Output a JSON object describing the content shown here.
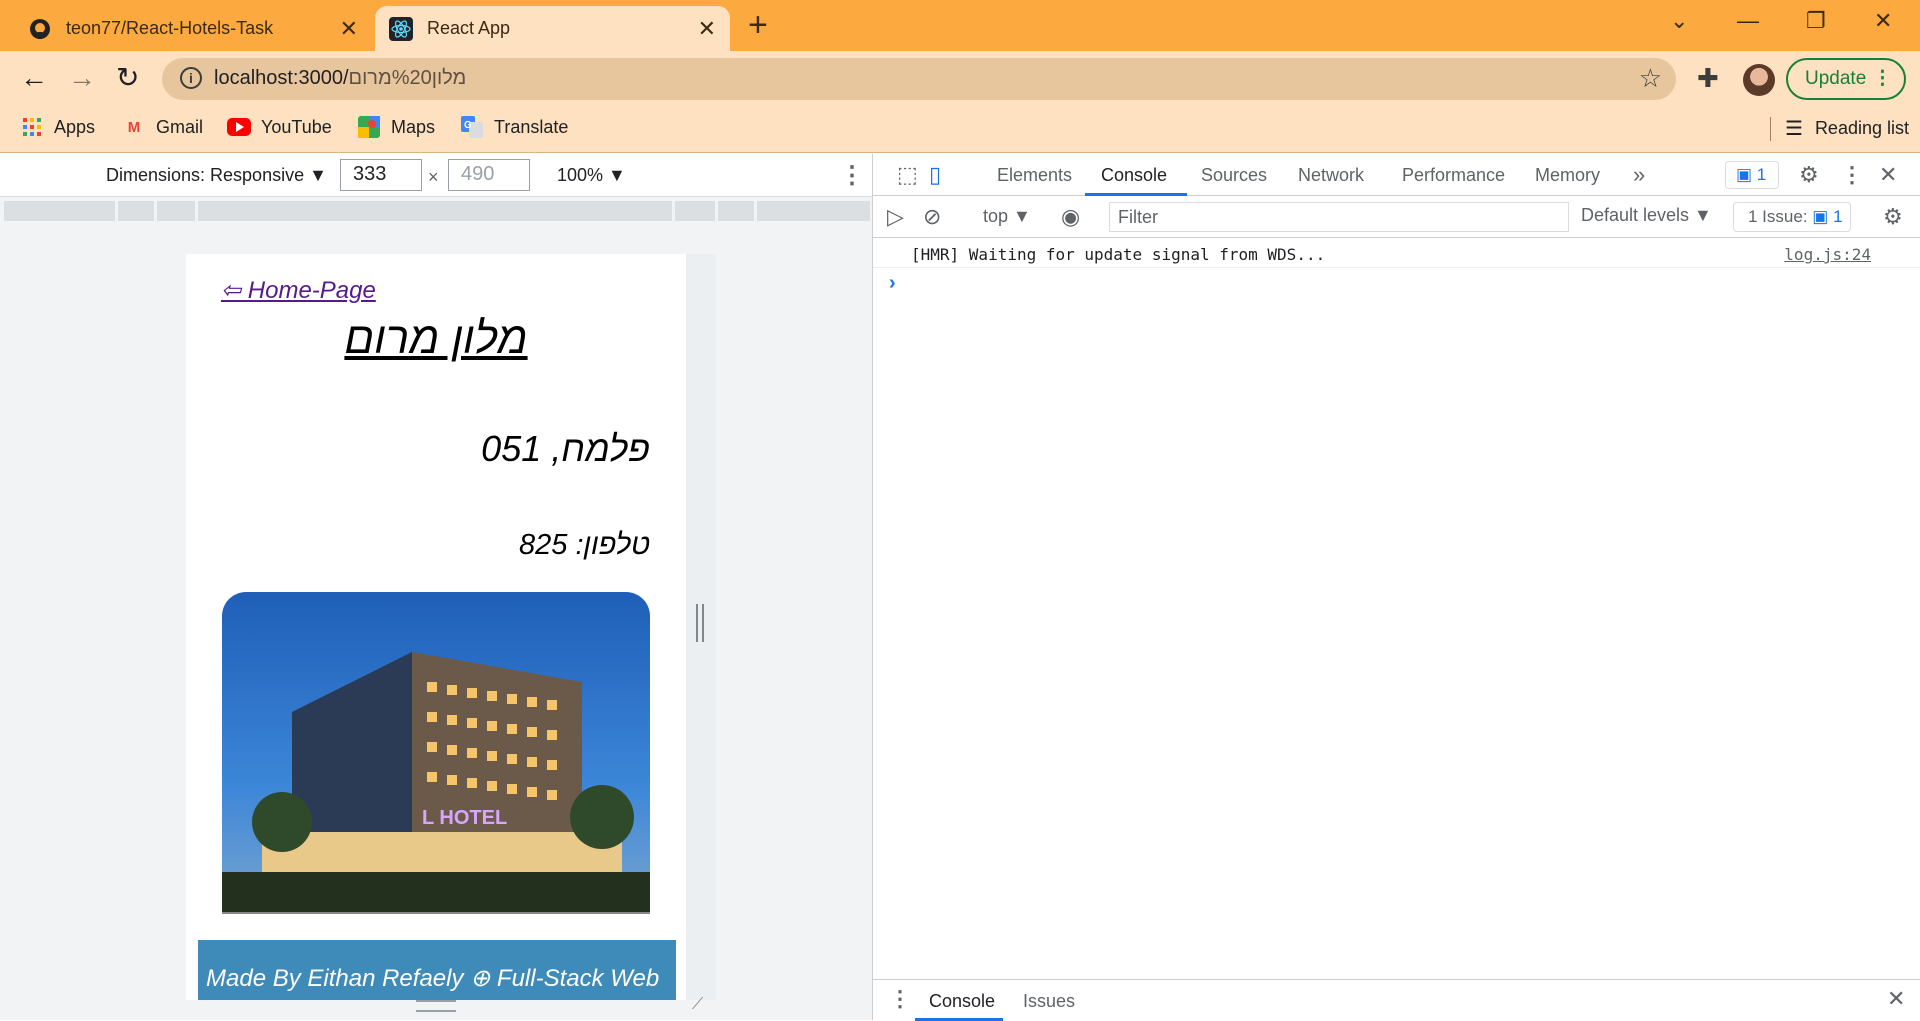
{
  "browser": {
    "tabs": [
      {
        "title": "teon77/React-Hotels-Task",
        "favicon": "github-icon"
      },
      {
        "title": "React App",
        "favicon": "react-icon",
        "active": true
      }
    ],
    "url": {
      "host": "localhost:3000/",
      "path": "מלון%20מרום"
    },
    "update_label": "Update",
    "bookmarks": [
      {
        "label": "Apps",
        "icon": "apps-grid-icon"
      },
      {
        "label": "Gmail",
        "icon": "gmail-icon"
      },
      {
        "label": "YouTube",
        "icon": "youtube-icon"
      },
      {
        "label": "Maps",
        "icon": "maps-icon"
      },
      {
        "label": "Translate",
        "icon": "translate-icon"
      }
    ],
    "reading_list": "Reading list"
  },
  "device_toolbar": {
    "dimensions_label": "Dimensions: Responsive ▼",
    "width": "333",
    "height_placeholder": "490",
    "zoom": "100% ▼",
    "times": "×"
  },
  "page": {
    "home_link": "⇦ Home-Page",
    "title": "מלון מרום",
    "address": "פלמח, 051",
    "phone": "טלפון: 825",
    "image_sign": "L HOTEL",
    "footer": "Made By Eithan Refaely ⊕ Full-Stack Web"
  },
  "devtools": {
    "tabs": [
      "Elements",
      "Console",
      "Sources",
      "Network",
      "Performance",
      "Memory"
    ],
    "active_tab": "Console",
    "message_badge": "1",
    "context": "top ▼",
    "filter_placeholder": "Filter",
    "levels": "Default levels ▼",
    "issues_label": "1 Issue:",
    "issues_count": "1",
    "log_message": "[HMR] Waiting for update signal from WDS...",
    "log_source": "log.js:24",
    "drawer_tabs": [
      "Console",
      "Issues"
    ]
  },
  "colors": {
    "tabstrip": "#fca93f",
    "toolbar": "#fde1c0",
    "accent": "#1a73e8",
    "footer": "#3e8ab9",
    "update": "#188038"
  }
}
